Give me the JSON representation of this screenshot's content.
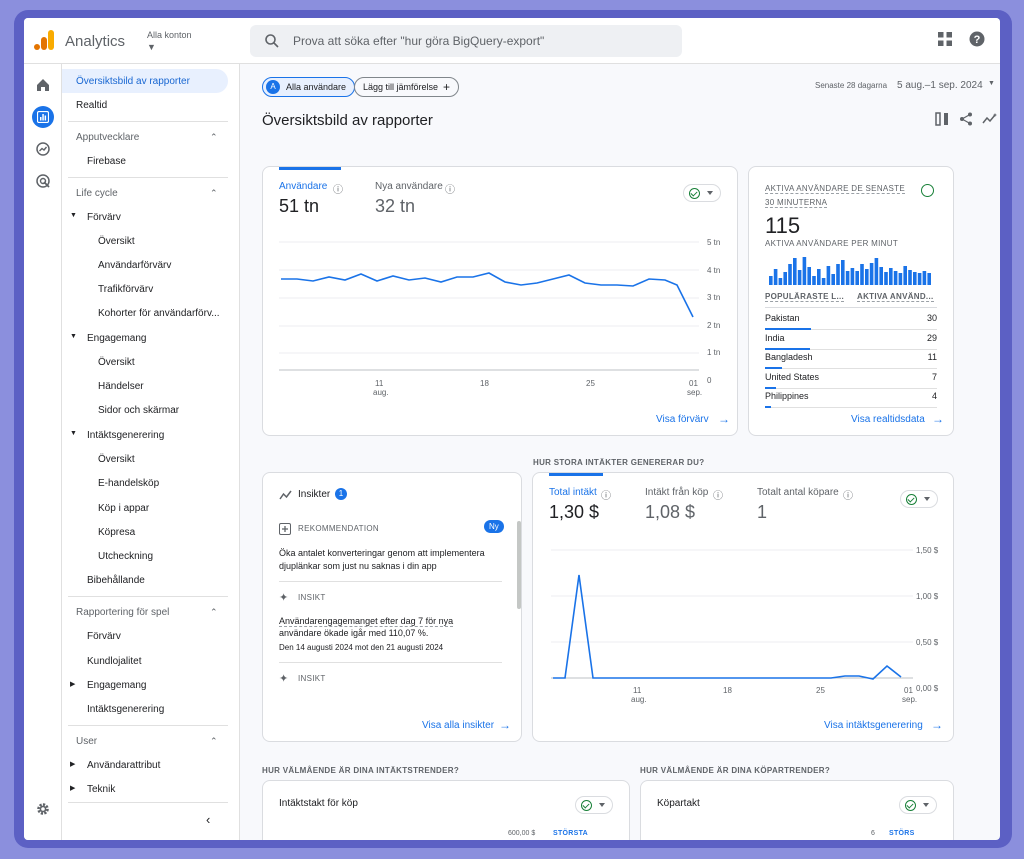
{
  "app": {
    "name": "Analytics",
    "account": "Alla konton"
  },
  "search": {
    "placeholder": "Prova att söka efter \"hur göra BigQuery-export\""
  },
  "nav": {
    "overview": "Översiktsbild av rapporter",
    "realtime": "Realtid",
    "app_dev": "Apputvecklare",
    "firebase": "Firebase",
    "lifecycle": "Life cycle",
    "acquisition": "Förvärv",
    "acq_overview": "Översikt",
    "user_acq": "Användarförvärv",
    "traffic_acq": "Trafikförvärv",
    "cohorts": "Kohorter för användarförv...",
    "engagement": "Engagemang",
    "eng_overview": "Översikt",
    "events": "Händelser",
    "pages": "Sidor och skärmar",
    "monetization": "Intäktsgenerering",
    "mon_overview": "Översikt",
    "ecom": "E-handelsköp",
    "inapp": "Köp i appar",
    "publisher": "Köpresa",
    "checkout": "Utcheckning",
    "retention": "Bibehållande",
    "games": "Rapportering för spel",
    "g_acq": "Förvärv",
    "g_loyalty": "Kundlojalitet",
    "g_eng": "Engagemang",
    "g_mon": "Intäktsgenerering",
    "user": "User",
    "user_attr": "Användarattribut",
    "tech": "Teknik"
  },
  "header": {
    "all_users": "Alla användare",
    "all_users_letter": "A",
    "add_compare": "Lägg till jämförelse",
    "date_label": "Senaste 28 dagarna",
    "date_range": "5 aug.–1 sep. 2024",
    "title": "Översiktsbild av rapporter"
  },
  "card_users": {
    "m1_label": "Användare",
    "m1_value": "51 tn",
    "m2_label": "Nya användare",
    "m2_value": "32 tn",
    "yticks": [
      "5 tn",
      "4 tn",
      "3 tn",
      "2 tn",
      "1 tn",
      "0"
    ],
    "xticks": [
      {
        "d": "11",
        "m": "aug."
      },
      {
        "d": "18",
        "m": ""
      },
      {
        "d": "25",
        "m": ""
      },
      {
        "d": "01",
        "m": "sep."
      }
    ],
    "link": "Visa förvärv"
  },
  "card_realtime": {
    "title1": "AKTIVA ANVÄNDARE DE SENASTE",
    "title2": "30 MINUTERNA",
    "value": "115",
    "per_min": "AKTIVA ANVÄNDARE PER MINUT",
    "col1": "POPULÄRASTE L...",
    "col2": "AKTIVA ANVÄND...",
    "rows": [
      {
        "name": "Pakistan",
        "value": "30"
      },
      {
        "name": "India",
        "value": "29"
      },
      {
        "name": "Bangladesh",
        "value": "11"
      },
      {
        "name": "United States",
        "value": "7"
      },
      {
        "name": "Philippines",
        "value": "4"
      }
    ],
    "link": "Visa realtidsdata"
  },
  "insights": {
    "title": "Insikter",
    "count": "1",
    "rec_label": "REKOMMENDATION",
    "new_badge": "Ny",
    "rec_text1": "Öka antalet konverteringar genom att implementera",
    "rec_text2": "djuplänkar som just nu saknas i din app",
    "ins_label": "INSIKT",
    "ins_text1": "Användarengagemanget efter dag 7 för nya",
    "ins_text2": "användare ökade igår med 110,07 %.",
    "ins_date": "Den 14 augusti 2024 mot den 21 augusti 2024",
    "ins_label2": "INSIKT",
    "link": "Visa alla insikter"
  },
  "revenue": {
    "question": "HUR STORA INTÄKTER GENERERAR DU?",
    "m1_label": "Total intäkt",
    "m1_value": "1,30 $",
    "m2_label": "Intäkt från köp",
    "m2_value": "1,08 $",
    "m3_label": "Totalt antal köpare",
    "m3_value": "1",
    "yticks": [
      "1,50 $",
      "1,00 $",
      "0,50 $",
      "0,00 $"
    ],
    "xticks": [
      {
        "d": "11",
        "m": "aug."
      },
      {
        "d": "18",
        "m": ""
      },
      {
        "d": "25",
        "m": ""
      },
      {
        "d": "01",
        "m": "sep."
      }
    ],
    "link": "Visa intäktsgenerering"
  },
  "bottom": {
    "q1": "HUR VÄLMÅENDE ÄR DINA INTÄKTSTRENDER?",
    "q2": "HUR VÄLMÅENDE ÄR DINA KÖPARTRENDER?",
    "c1_title": "Intäktstakt för köp",
    "c1_axis": "600,00 $",
    "c1_legend": "STÖRSTA",
    "c2_title": "Köpartakt",
    "c2_axis": "6",
    "c2_legend": "STÖRS"
  },
  "colors": {
    "accent": "#1a73e8",
    "good": "#188038"
  }
}
